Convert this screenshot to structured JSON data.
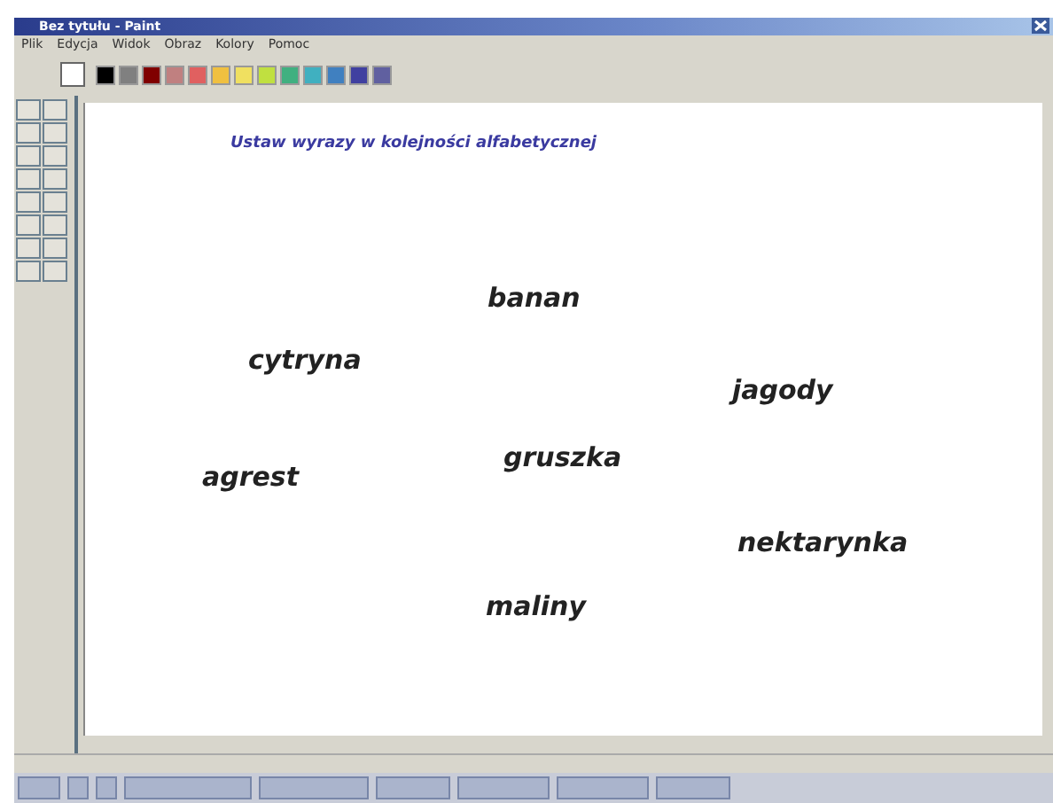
{
  "window": {
    "title": "Bez tytułu - Paint"
  },
  "menu": [
    "Plik",
    "Edycja",
    "Widok",
    "Obraz",
    "Kolory",
    "Pomoc"
  ],
  "palette": [
    {
      "color": "#000000"
    },
    {
      "color": "#808080"
    },
    {
      "color": "#800000"
    },
    {
      "color": "#c08080"
    },
    {
      "color": "#e06060"
    },
    {
      "color": "#f0c040"
    },
    {
      "color": "#f0e060"
    },
    {
      "color": "#c0e040"
    },
    {
      "color": "#40b080"
    },
    {
      "color": "#40b0c0"
    },
    {
      "color": "#4080c0"
    },
    {
      "color": "#4040a0"
    },
    {
      "color": "#6060a0"
    }
  ],
  "canvas": {
    "heading": "Ustaw wyrazy w kolejności alfabetycznej",
    "words": [
      "banan",
      "cytryna",
      "jagody",
      "gruszka",
      "agrest",
      "nektarynka",
      "maliny"
    ]
  }
}
